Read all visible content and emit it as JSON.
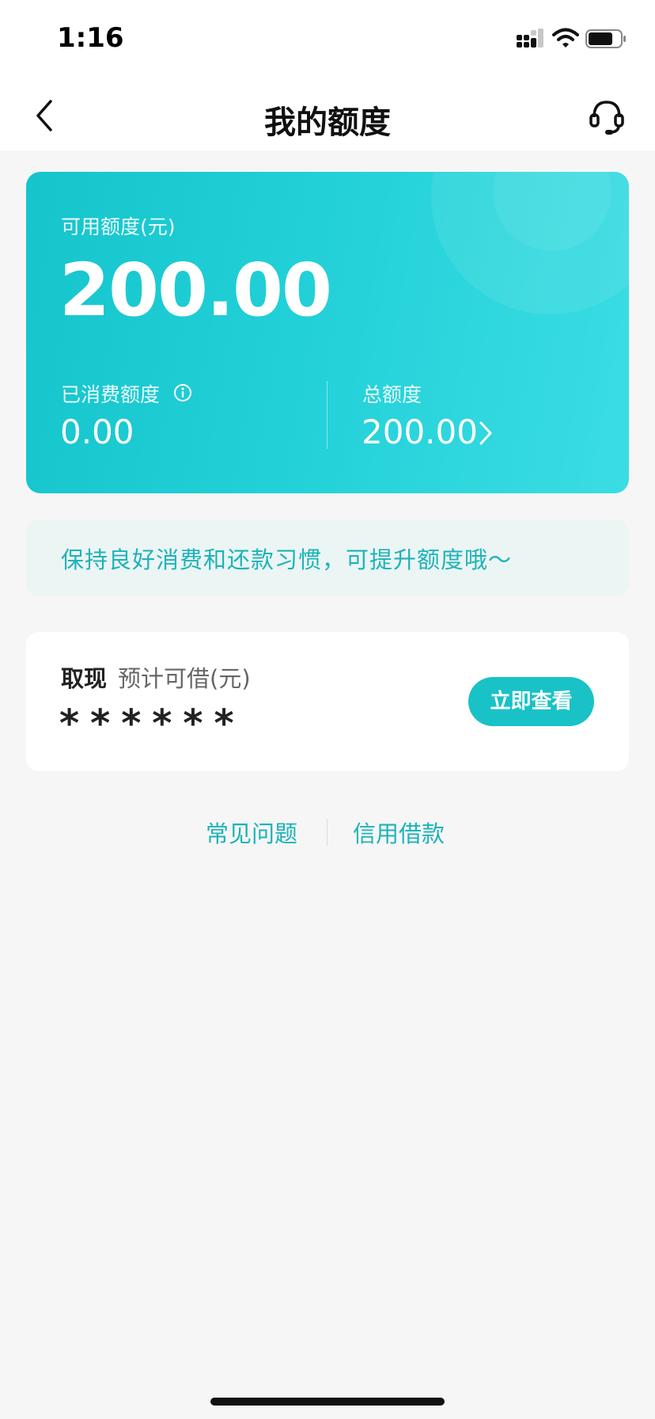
{
  "status_bar": {
    "time": "1:16"
  },
  "nav": {
    "title": "我的额度"
  },
  "credit_card": {
    "available_label": "可用额度(元)",
    "available_value": "200.00",
    "used_label": "已消费额度",
    "used_value": "0.00",
    "total_label": "总额度",
    "total_value": "200.00"
  },
  "tip": {
    "text": "保持良好消费和还款习惯，可提升额度哦～"
  },
  "cash": {
    "title": "取现",
    "subtitle": "预计可借(元)",
    "masked_amount": "******",
    "button_label": "立即查看"
  },
  "links": {
    "faq": "常见问题",
    "loan": "信用借款"
  },
  "colors": {
    "accent": "#19c2c6",
    "card_start": "#16c4cc",
    "card_end": "#3adde3",
    "tip_bg": "#ebf5f4"
  },
  "icons": [
    "signal-icon",
    "wifi-icon",
    "battery-icon",
    "back-icon",
    "headset-icon",
    "info-icon",
    "chevron-right-icon"
  ]
}
